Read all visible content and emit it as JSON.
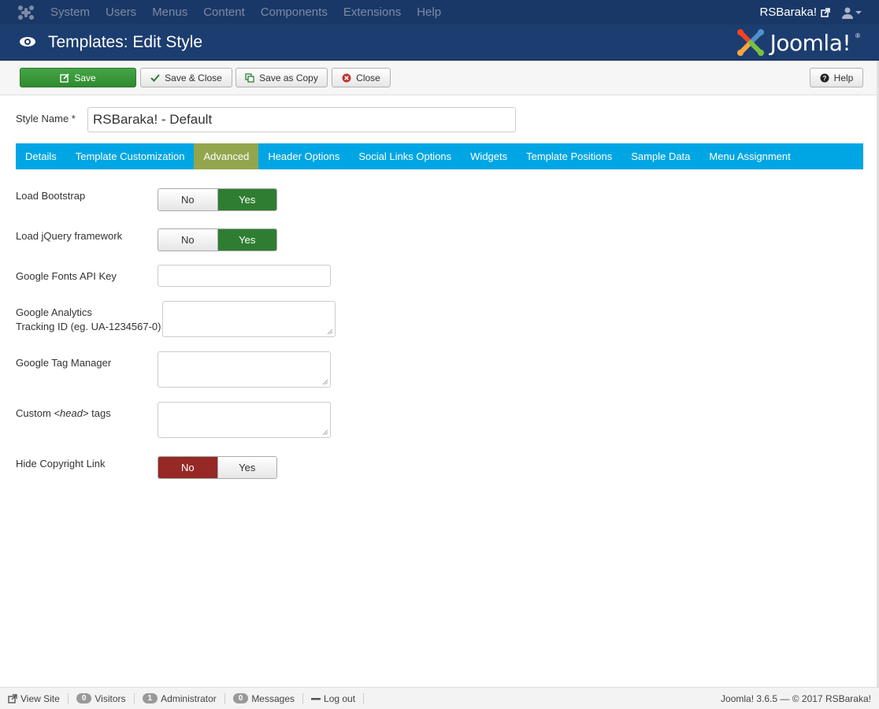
{
  "topmenu": {
    "items": [
      "System",
      "Users",
      "Menus",
      "Content",
      "Components",
      "Extensions",
      "Help"
    ],
    "site_name": "RSBaraka!"
  },
  "header": {
    "title": "Templates: Edit Style",
    "brand": "Joomla!",
    "reg": "®"
  },
  "toolbar": {
    "save": "Save",
    "save_close": "Save & Close",
    "save_copy": "Save as Copy",
    "close": "Close",
    "help": "Help"
  },
  "style_name": {
    "label": "Style Name *",
    "value": "RSBaraka! - Default"
  },
  "tabs": [
    "Details",
    "Template Customization",
    "Advanced",
    "Header Options",
    "Social Links Options",
    "Widgets",
    "Template Positions",
    "Sample Data",
    "Menu Assignment"
  ],
  "active_tab": "Advanced",
  "fields": {
    "load_bootstrap": {
      "label": "Load Bootstrap",
      "no": "No",
      "yes": "Yes",
      "value": "Yes"
    },
    "load_jquery": {
      "label": "Load jQuery framework",
      "no": "No",
      "yes": "Yes",
      "value": "Yes"
    },
    "google_fonts": {
      "label": "Google Fonts API Key",
      "value": ""
    },
    "google_analytics": {
      "label_line1": "Google Analytics",
      "label_line2": "Tracking ID (eg. UA-1234567-0)",
      "value": ""
    },
    "google_tag": {
      "label": "Google Tag Manager",
      "value": ""
    },
    "custom_head": {
      "label_pre": "Custom ",
      "label_em": "<head>",
      "label_post": " tags",
      "value": ""
    },
    "hide_copyright": {
      "label": "Hide Copyright Link",
      "no": "No",
      "yes": "Yes",
      "value": "No"
    }
  },
  "footer": {
    "view_site": "View Site",
    "visitors_count": "0",
    "visitors": "Visitors",
    "admin_count": "1",
    "admin": "Administrator",
    "messages_count": "0",
    "messages": "Messages",
    "logout": "Log out",
    "copyright": "Joomla! 3.6.5 — © 2017 RSBaraka!"
  },
  "colors": {
    "topbar": "#1a3867",
    "header": "#1c3d6f",
    "tabs": "#00a6e4",
    "active_tab": "#93a64e",
    "yes_active": "#2f7d32",
    "no_active": "#962826",
    "save_button": "#46a546"
  },
  "icons": [
    "joomla-logo-icon",
    "external-link-icon",
    "user-icon",
    "eye-icon",
    "edit-icon",
    "check-icon",
    "copy-icon",
    "close-circle-icon",
    "help-circle-icon",
    "resize-grip-icon",
    "minus-icon"
  ]
}
